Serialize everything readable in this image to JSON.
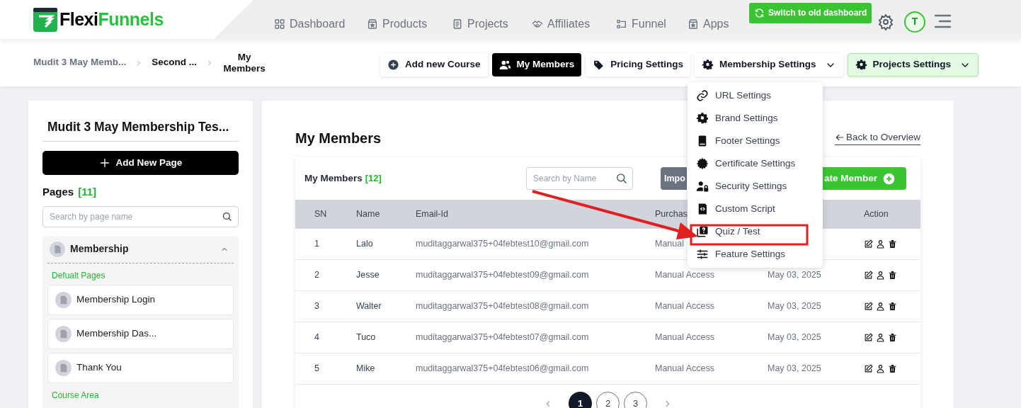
{
  "logo": {
    "text": "Flexi",
    "accent": "Funnels"
  },
  "nav": [
    {
      "label": "Dashboard"
    },
    {
      "label": "Products"
    },
    {
      "label": "Projects"
    },
    {
      "label": "Affiliates"
    },
    {
      "label": "Funnel"
    },
    {
      "label": "Apps"
    }
  ],
  "switch_button": "Switch to old dashboard",
  "avatar": "T",
  "breadcrumbs": [
    "Mudit 3 May Memb...",
    "Second ...",
    "My Members"
  ],
  "toolbar": [
    {
      "label": "Add new Course",
      "kind": "button",
      "selected": false
    },
    {
      "label": "My Members",
      "kind": "button",
      "selected": true
    },
    {
      "label": "Pricing Settings",
      "kind": "button",
      "selected": false
    },
    {
      "label": "Membership Settings",
      "kind": "dropdown",
      "selected": false
    },
    {
      "label": "Projects Settings",
      "kind": "accent",
      "selected": false
    }
  ],
  "menu": {
    "items": [
      {
        "label": "URL Settings"
      },
      {
        "label": "Brand Settings"
      },
      {
        "label": "Footer Settings"
      },
      {
        "label": "Certificate Settings"
      },
      {
        "label": "Security Settings"
      },
      {
        "label": "Custom Script"
      },
      {
        "label": "Quiz / Test"
      },
      {
        "label": "Feature Settings"
      }
    ]
  },
  "sidebar": {
    "title": "Mudit 3 May Membership Tes...",
    "add_button": "Add New Page",
    "pages_label": "Pages",
    "pages_count": "[11]",
    "search": {
      "placeholder": "Search by page name"
    },
    "group": {
      "title": "Membership",
      "expanded": true,
      "sections": [
        {
          "heading": "Defualt Pages",
          "pages": [
            "Membership Login",
            "Membership Das...",
            "Thank You"
          ]
        },
        {
          "heading": "Course Area"
        }
      ]
    }
  },
  "main": {
    "title": "My Members",
    "back_link": "Back to Overview",
    "table_card": {
      "title": "My Members",
      "count": "[12]",
      "search": {
        "placeholder": "Search by Name"
      },
      "import_button": "Impo",
      "create_button": "ate Member",
      "columns": {
        "sn": "SN",
        "name": "Name",
        "email": "Email-Id",
        "purchase": "Purchas",
        "action": "Action"
      },
      "rows": [
        {
          "sn": "1",
          "name": "Lalo",
          "email": "muditaggarwal375+04febtest10@gmail.com",
          "purchase": "Manual"
        },
        {
          "sn": "2",
          "name": "Jesse",
          "email": "muditaggarwal375+04febtest09@gmail.com",
          "purchase": "Manual Access",
          "date": "May 03, 2025"
        },
        {
          "sn": "3",
          "name": "Walter",
          "email": "muditaggarwal375+04febtest08@gmail.com",
          "purchase": "Manual Access",
          "date": "May 03, 2025"
        },
        {
          "sn": "4",
          "name": "Tuco",
          "email": "muditaggarwal375+04febtest07@gmail.com",
          "purchase": "Manual Access",
          "date": "May 03, 2025"
        },
        {
          "sn": "5",
          "name": "Mike",
          "email": "muditaggarwal375+04febtest06@gmail.com",
          "purchase": "Manual Access",
          "date": "May 03, 2025"
        }
      ],
      "pagination": [
        {
          "label": "1",
          "selected": true
        },
        {
          "label": "2",
          "selected": false
        },
        {
          "label": "3",
          "selected": false
        }
      ]
    }
  }
}
